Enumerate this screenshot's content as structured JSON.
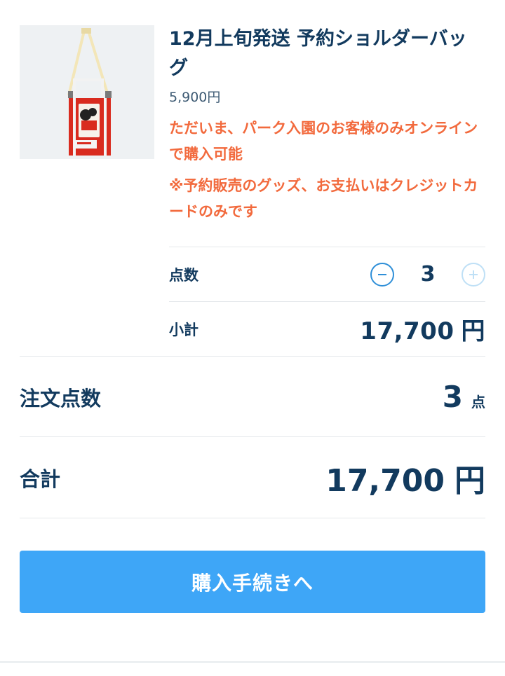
{
  "product": {
    "image": "tote-shoulder-bag-mickey-minnie",
    "title": "12月上旬発送 予約ショルダーバッグ",
    "price": "5,900円",
    "notice_online": "ただいま、パーク入園のお客様のみオンラインで購入可能",
    "notice_payment": "※予約販売のグッズ、お支払いはクレジットカードのみです"
  },
  "quantity": {
    "label": "点数",
    "value": "3",
    "decrement_icon": "minus-circle-icon",
    "increment_icon": "plus-circle-icon"
  },
  "subtotal": {
    "label": "小計",
    "value": "17,700",
    "unit": "円"
  },
  "order_count": {
    "label": "注文点数",
    "value": "3",
    "unit": "点"
  },
  "total": {
    "label": "合計",
    "value": "17,700",
    "unit": "円"
  },
  "checkout": {
    "label": "購入手続きへ"
  },
  "colors": {
    "text": "#123a5e",
    "notice": "#f26a3d",
    "button": "#3ea6f7",
    "stepper_active": "#2f8fd8",
    "stepper_disabled": "#bfe0f6"
  }
}
